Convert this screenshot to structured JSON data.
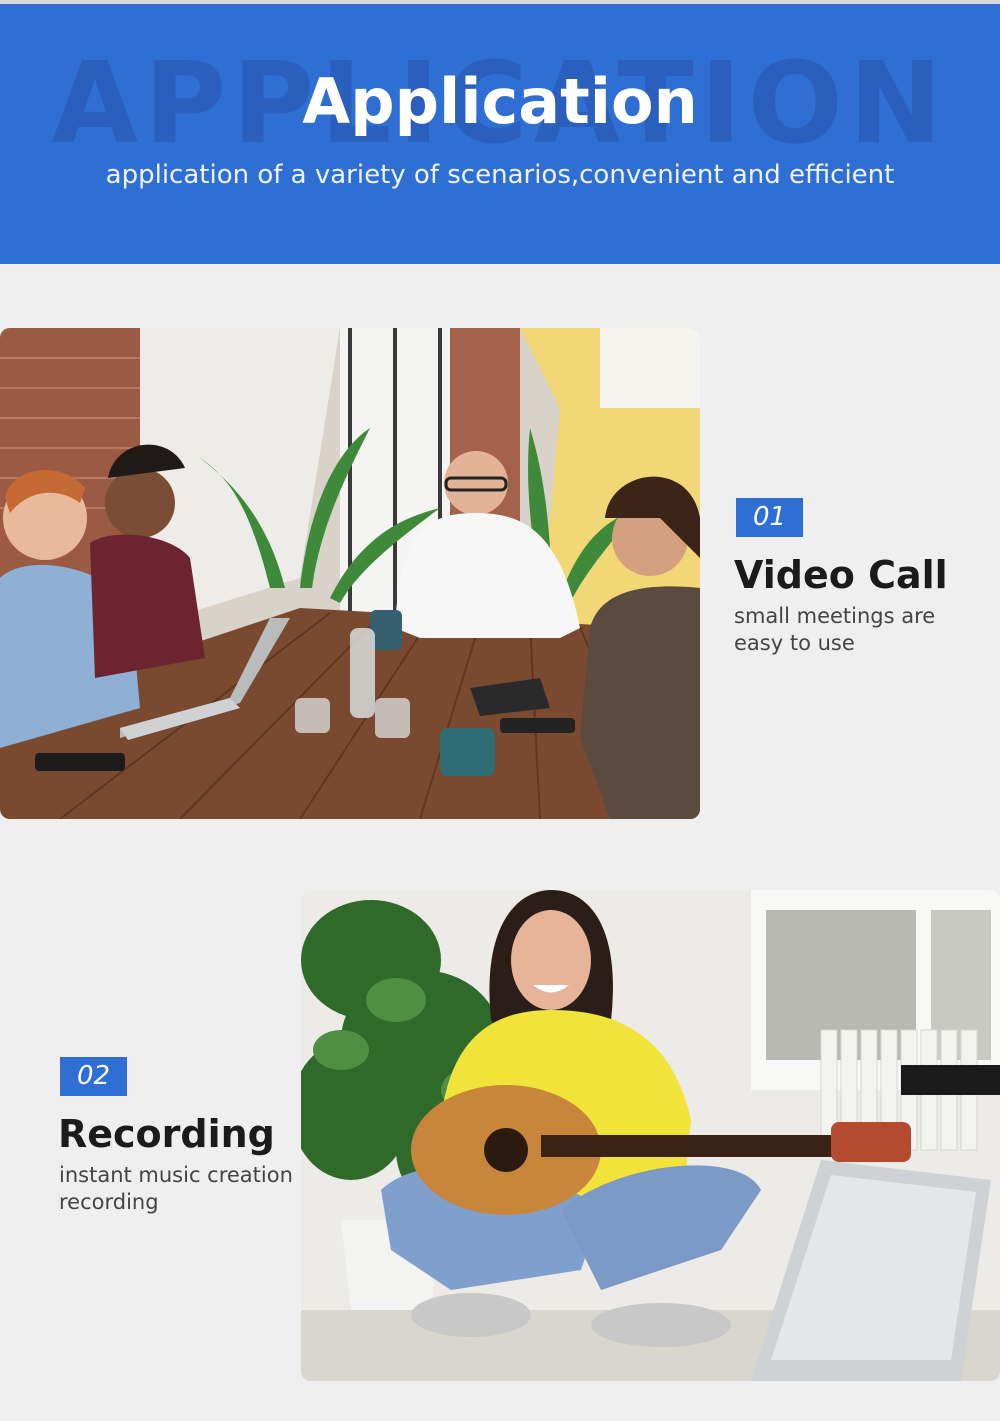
{
  "banner": {
    "bg_text": "APPLICATION",
    "title": "Application",
    "subtitle": "application of a variety of scenarios,convenient and efficient"
  },
  "features": [
    {
      "number": "01",
      "title": "Video Call",
      "description": "small meetings are easy to use"
    },
    {
      "number": "02",
      "title": "Recording",
      "description": "instant music creation recording"
    }
  ],
  "colors": {
    "accent": "#2f6fd3",
    "background": "#efefef"
  }
}
